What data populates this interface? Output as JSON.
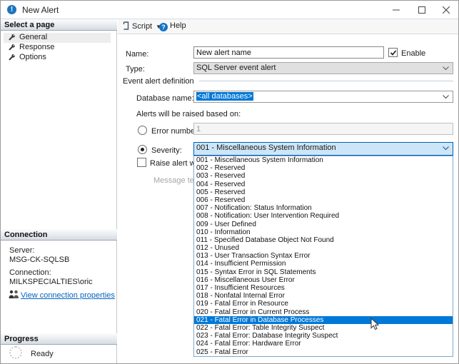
{
  "window": {
    "title": "New Alert"
  },
  "sidebar": {
    "select_page": {
      "header": "Select a page",
      "items": [
        {
          "label": "General"
        },
        {
          "label": "Response"
        },
        {
          "label": "Options"
        }
      ]
    },
    "connection": {
      "header": "Connection",
      "server_label": "Server:",
      "server_value": "MSG-CK-SQLSB",
      "connection_label": "Connection:",
      "connection_value": "MILKSPECIALTIES\\oric",
      "link_label": "View connection properties"
    },
    "progress": {
      "header": "Progress",
      "status": "Ready"
    }
  },
  "toolbar": {
    "script_label": "Script",
    "help_label": "Help"
  },
  "form": {
    "name_label": "Name:",
    "name_value": "New alert name",
    "enable_label": "Enable",
    "type_label": "Type:",
    "type_value": "SQL Server event alert",
    "group_label": "Event alert definition",
    "database_label": "Database name:",
    "database_value": "<all databases>",
    "raised_based_label": "Alerts will be raised based on:",
    "error_number_label": "Error number:",
    "error_number_value": "1",
    "severity_label": "Severity:",
    "severity_value": "001 - Miscellaneous System Information",
    "raise_alert_label": "Raise alert when messa",
    "message_text_label": "Message text:"
  },
  "severity_dropdown": {
    "highlighted_index": 20,
    "options": [
      "001 - Miscellaneous System Information",
      "002 - Reserved",
      "003 - Reserved",
      "004 - Reserved",
      "005 - Reserved",
      "006 - Reserved",
      "007 - Notification: Status Information",
      "008 - Notification: User Intervention Required",
      "009 - User Defined",
      "010 - Information",
      "011 - Specified Database Object Not Found",
      "012 - Unused",
      "013 - User Transaction Syntax Error",
      "014 - Insufficient Permission",
      "015 - Syntax Error in SQL Statements",
      "016 - Miscellaneous User Error",
      "017 - Insufficient Resources",
      "018 - Nonfatal Internal Error",
      "019 - Fatal Error in Resource",
      "020 - Fatal Error in Current Process",
      "021 - Fatal Error in Database Processes",
      "022 - Fatal Error: Table Integrity Suspect",
      "023 - Fatal Error: Database Integrity Suspect",
      "024 - Fatal Error: Hardware Error",
      "025 - Fatal Error"
    ]
  },
  "icons": {
    "title": "alert-icon",
    "sidebar_item": "wrench-icon",
    "link": "people-icon",
    "progress": "spinner-icon",
    "script": "script-icon",
    "help": "help-icon",
    "combo": "chevron-down-icon",
    "pointer": "mouse-cursor-icon"
  },
  "colors": {
    "accent_blue": "#0078d7",
    "combo_focus_bg": "#cde6f7",
    "combo_focus_border": "#005fb8",
    "link": "#0563c1",
    "title_icon": "#1e73be"
  }
}
